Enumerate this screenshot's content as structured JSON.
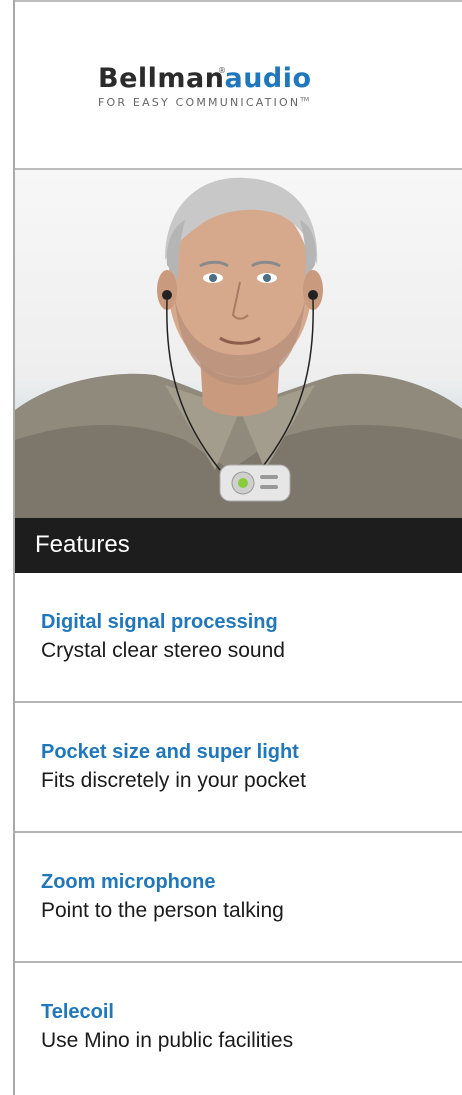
{
  "brand": {
    "name_part1": "Bellman",
    "name_part2": "audio",
    "registered": "®",
    "tagline": "FOR EASY COMMUNICATION",
    "trademark": "TM"
  },
  "features": {
    "heading": "Features",
    "items": [
      {
        "title": "Digital signal processing",
        "description": "Crystal clear stereo sound"
      },
      {
        "title": "Pocket size and super light",
        "description": "Fits discretely in your pocket"
      },
      {
        "title": "Zoom microphone",
        "description": "Point to the person talking"
      },
      {
        "title": "Telecoil",
        "description": "Use Mino in public facilities"
      }
    ]
  },
  "colors": {
    "accent_blue": "#1f77bd",
    "header_bar": "#1d1d1d",
    "divider": "#b5b5b5"
  }
}
